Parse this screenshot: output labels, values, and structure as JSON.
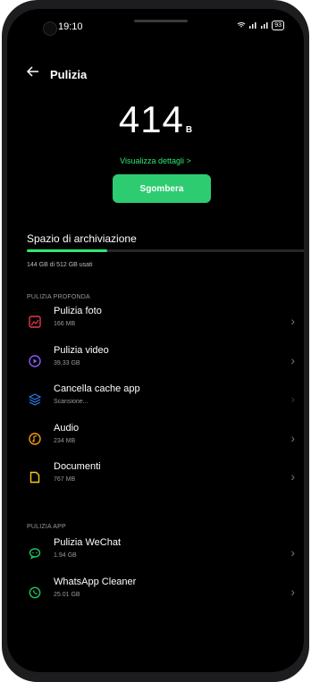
{
  "status": {
    "time": "19:10",
    "battery": "93"
  },
  "header": {
    "title": "Pulizia"
  },
  "summary": {
    "value": "414",
    "unit": "B",
    "details_link": "Visualizza dettagli >",
    "clean_button": "Sgombera"
  },
  "storage": {
    "title": "Spazio di archiviazione",
    "used_text": "144 GB di 512 GB usati",
    "used_fraction": 0.28
  },
  "deep_clean": {
    "label": "PULIZIA PROFONDA",
    "items": [
      {
        "name": "Pulizia foto",
        "sub": "166 MB",
        "icon": "photo-icon",
        "color": "#e8394a"
      },
      {
        "name": "Pulizia video",
        "sub": "39,33 GB",
        "icon": "play-icon",
        "color": "#8a5cf6"
      },
      {
        "name": "Cancella cache app",
        "sub": "Scansione...",
        "icon": "layers-icon",
        "color": "#2f7cf6"
      },
      {
        "name": "Audio",
        "sub": "234 MB",
        "icon": "music-icon",
        "color": "#f59e0b"
      },
      {
        "name": "Documenti",
        "sub": "767 MB",
        "icon": "document-icon",
        "color": "#facc15"
      }
    ]
  },
  "app_clean": {
    "label": "PULIZIA APP",
    "items": [
      {
        "name": "Pulizia WeChat",
        "sub": "1.94 GB",
        "icon": "wechat-icon",
        "color": "#22c55e"
      },
      {
        "name": "WhatsApp Cleaner",
        "sub": "25.01 GB",
        "icon": "whatsapp-icon",
        "color": "#22c55e"
      }
    ]
  }
}
